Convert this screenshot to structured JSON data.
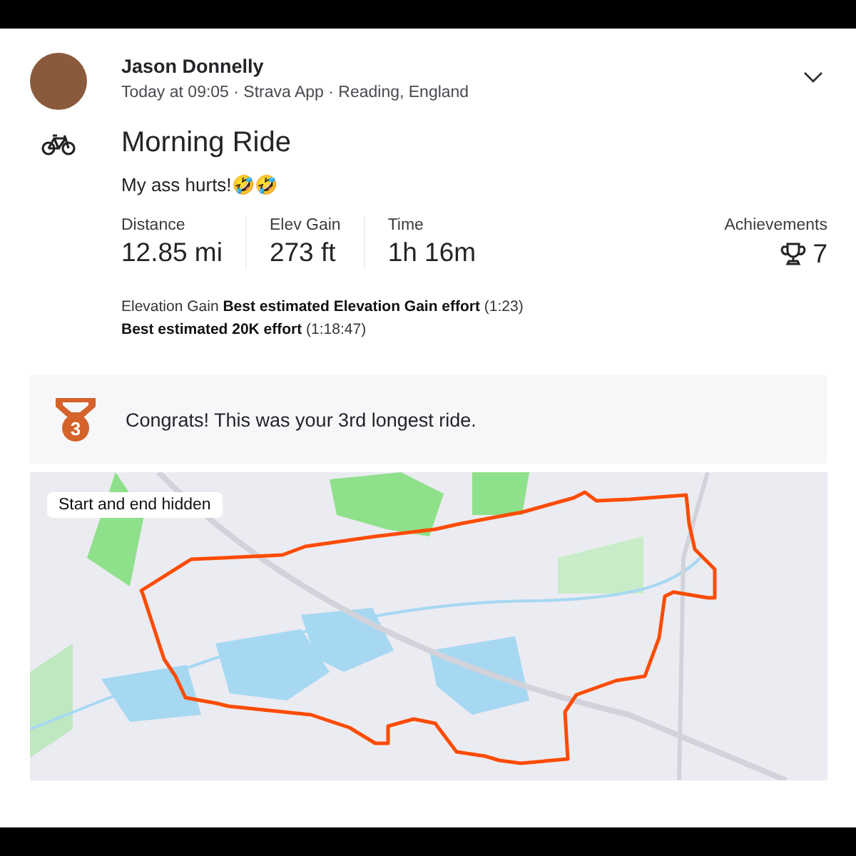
{
  "athlete": {
    "name": "Jason Donnelly",
    "meta": "Today at 09:05 · Strava App · Reading, England"
  },
  "activity": {
    "kind": "ride",
    "title": "Morning Ride",
    "description": "My ass hurts!🤣🤣"
  },
  "stats": [
    {
      "label": "Distance",
      "value": "12.85 mi"
    },
    {
      "label": "Elev Gain",
      "value": "273 ft"
    },
    {
      "label": "Time",
      "value": "1h 16m"
    }
  ],
  "achievements": {
    "label": "Achievements",
    "count": "7"
  },
  "efforts": [
    "Elevation Gain **Best estimated Elevation Gain effort** (1:23)",
    "**Best estimated 20K effort** (1:18:47)"
  ],
  "banner": {
    "rank": "3",
    "text": "Congrats! This was your 3rd longest ride."
  },
  "map": {
    "badge": "Start and end hidden"
  }
}
